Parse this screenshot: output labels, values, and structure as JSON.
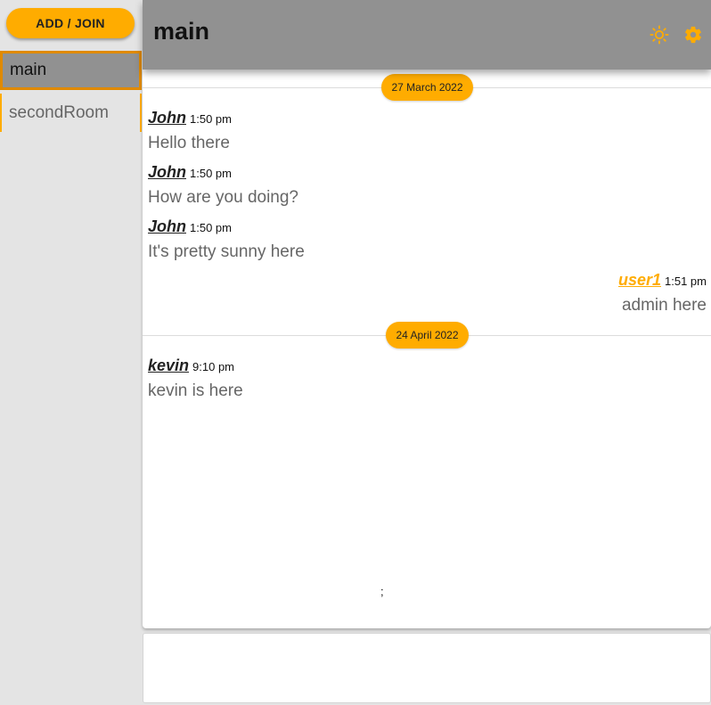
{
  "sidebar": {
    "add_join_label": "ADD / JOIN",
    "rooms": [
      {
        "label": "main",
        "active": true
      },
      {
        "label": "secondRoom",
        "active": false
      }
    ]
  },
  "header": {
    "room_title": "main",
    "icons": [
      "sun-icon",
      "gear-icon"
    ]
  },
  "chat": {
    "groups": [
      {
        "date": "27 March 2022",
        "messages": [
          {
            "author": "John",
            "time": "1:50 pm",
            "text": "Hello there",
            "own": false
          },
          {
            "author": "John",
            "time": "1:50 pm",
            "text": "How are you doing?",
            "own": false
          },
          {
            "author": "John",
            "time": "1:50 pm",
            "text": "It's pretty sunny here",
            "own": false
          },
          {
            "author": "user1",
            "time": "1:51 pm",
            "text": "admin here",
            "own": true
          }
        ]
      },
      {
        "date": "24 April 2022",
        "messages": [
          {
            "author": "kevin",
            "time": "9:10 pm",
            "text": "kevin is here",
            "own": false
          }
        ]
      }
    ],
    "stray_text": ";"
  },
  "input": {
    "value": "",
    "placeholder": ""
  },
  "colors": {
    "accent": "#ffac00",
    "header_bg": "#919191",
    "sidebar_bg": "#e4e4e4"
  }
}
